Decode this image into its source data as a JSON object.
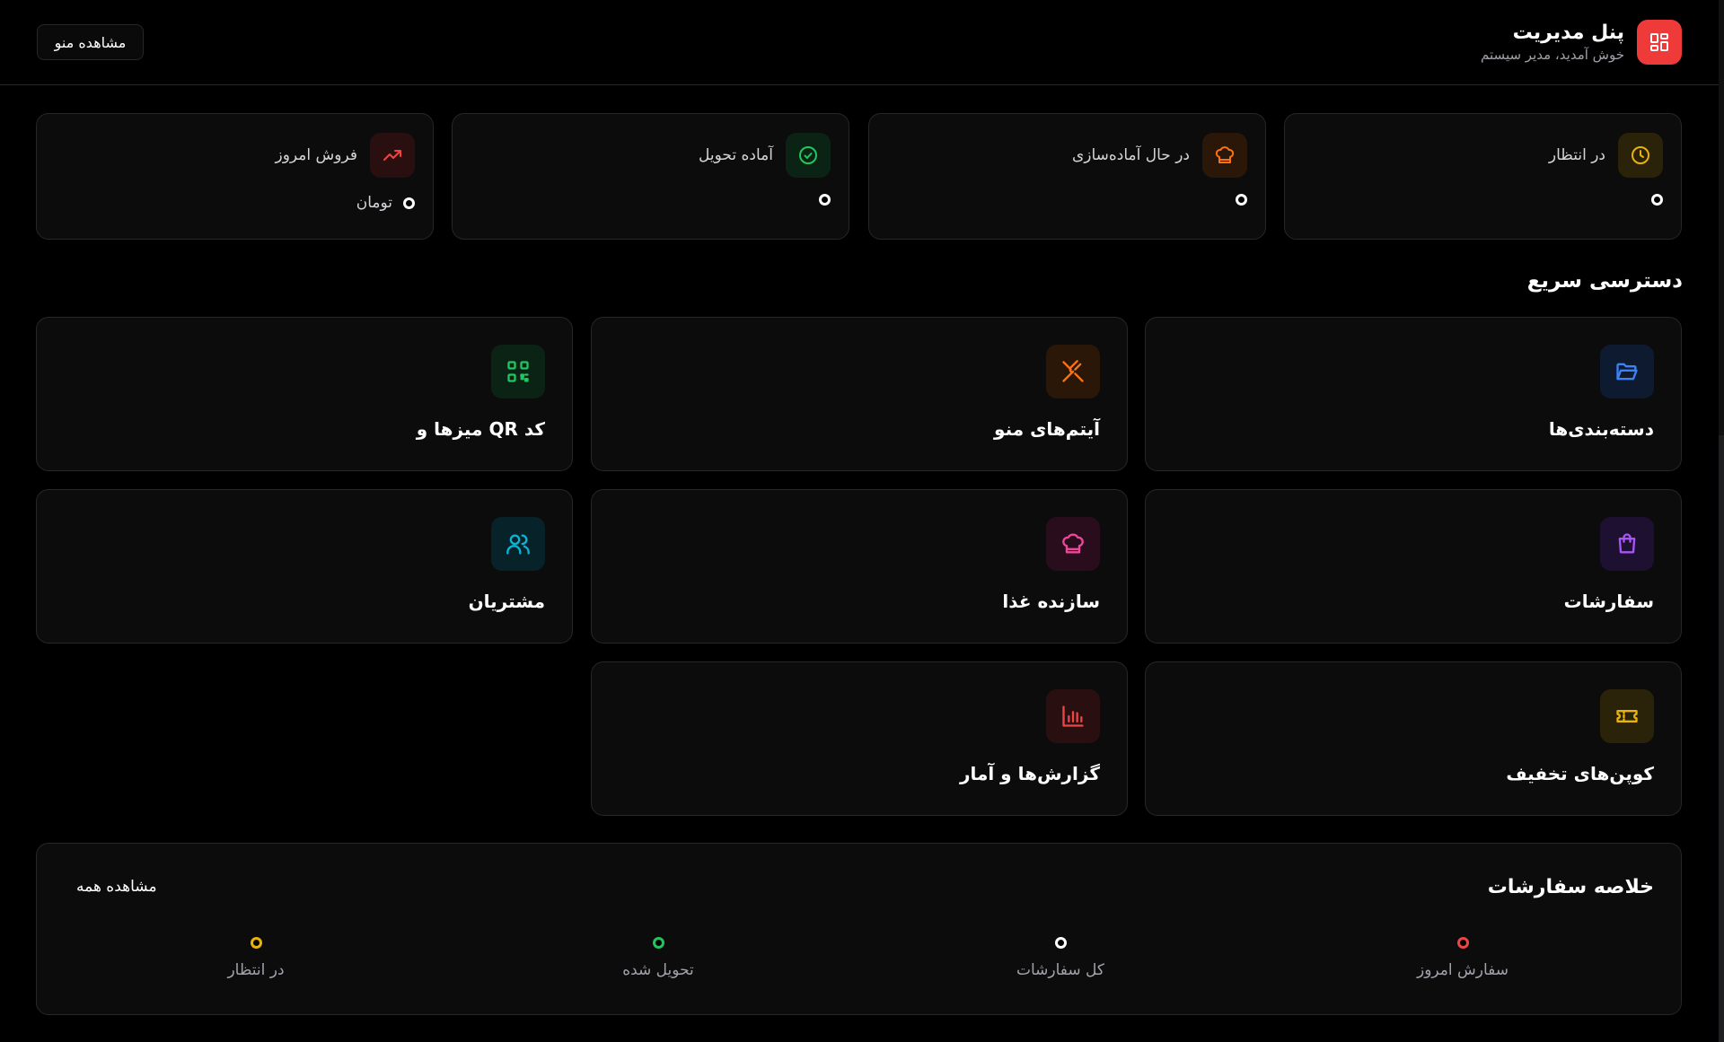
{
  "header": {
    "title": "پنل مدیریت",
    "subtitle": "خوش آمدید، مدیر سیستم",
    "view_menu_label": "مشاهده منو",
    "logo_icon": "dashboard-grid-icon",
    "logo_color": "#ef3a3a"
  },
  "stats": [
    {
      "label": "در انتظار",
      "icon": "clock-icon",
      "color": "#eab308",
      "value": "",
      "unit": ""
    },
    {
      "label": "در حال آماده‌سازی",
      "icon": "chef-hat-icon",
      "color": "#f97316",
      "value": "",
      "unit": ""
    },
    {
      "label": "آماده تحویل",
      "icon": "check-circle-icon",
      "color": "#22c55e",
      "value": "",
      "unit": ""
    },
    {
      "label": "فروش امروز",
      "icon": "trending-up-icon",
      "color": "#ef4444",
      "value": "",
      "unit": "تومان"
    }
  ],
  "quick_access": {
    "title": "دسترسی سریع",
    "items": [
      {
        "label": "دسته‌بندی‌ها",
        "icon": "folder-icon",
        "color": "#3b82f6"
      },
      {
        "label": "آیتم‌های منو",
        "icon": "utensils-icon",
        "color": "#f97316"
      },
      {
        "label": "میزها و QR کد",
        "icon": "qr-code-icon",
        "color": "#22c55e"
      },
      {
        "label": "سفارشات",
        "icon": "shopping-bag-icon",
        "color": "#a855f7"
      },
      {
        "label": "سازنده غذا",
        "icon": "chef-hat-icon",
        "color": "#ec4899"
      },
      {
        "label": "مشتریان",
        "icon": "users-icon",
        "color": "#06b6d4"
      },
      {
        "label": "کوپن‌های تخفیف",
        "icon": "ticket-icon",
        "color": "#eab308"
      },
      {
        "label": "گزارش‌ها و آمار",
        "icon": "bar-chart-icon",
        "color": "#ef4444"
      }
    ]
  },
  "summary": {
    "title": "خلاصه سفارشات",
    "view_all_label": "مشاهده همه",
    "items": [
      {
        "label": "سفارش امروز",
        "color": "#ef4444"
      },
      {
        "label": "کل سفارشات",
        "color": "#ffffff"
      },
      {
        "label": "تحویل شده",
        "color": "#22c55e"
      },
      {
        "label": "در انتظار",
        "color": "#eab308"
      }
    ]
  }
}
